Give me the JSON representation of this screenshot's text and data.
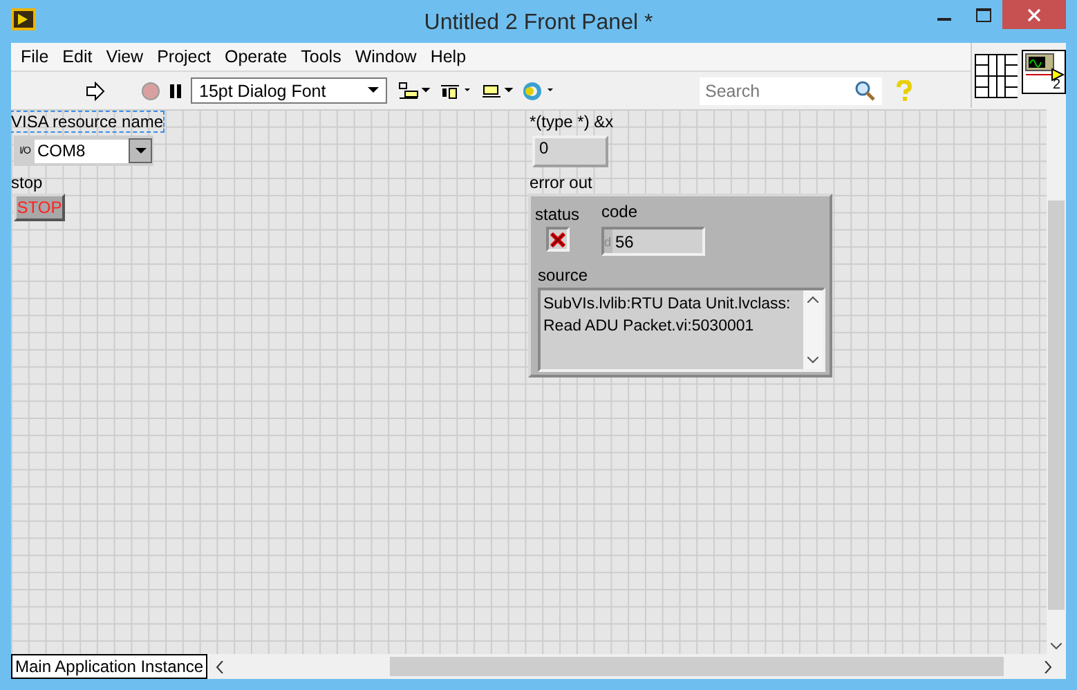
{
  "window": {
    "title": "Untitled 2 Front Panel *"
  },
  "menu": [
    "File",
    "Edit",
    "View",
    "Project",
    "Operate",
    "Tools",
    "Window",
    "Help"
  ],
  "toolbar": {
    "font": "15pt Dialog Font",
    "search": {
      "placeholder": "Search"
    },
    "vi_icon_number": "2"
  },
  "panel": {
    "visa": {
      "label": "VISA resource name",
      "io_glyph": "I/O",
      "value": "COM8",
      "selected": true
    },
    "stop": {
      "label": "stop",
      "button_text": "STOP"
    },
    "pointer": {
      "label": "*(type *) &x",
      "value": "0"
    },
    "error_out": {
      "label": "error out",
      "status": {
        "label": "status",
        "error": true
      },
      "code": {
        "label": "code",
        "radix": "d",
        "value": "56"
      },
      "source": {
        "label": "source",
        "lines": [
          "SubVIs.lvlib:RTU Data Unit.lvclass:",
          "Read ADU Packet.vi:5030001"
        ]
      }
    }
  },
  "status_bar": {
    "context": "Main Application Instance"
  }
}
